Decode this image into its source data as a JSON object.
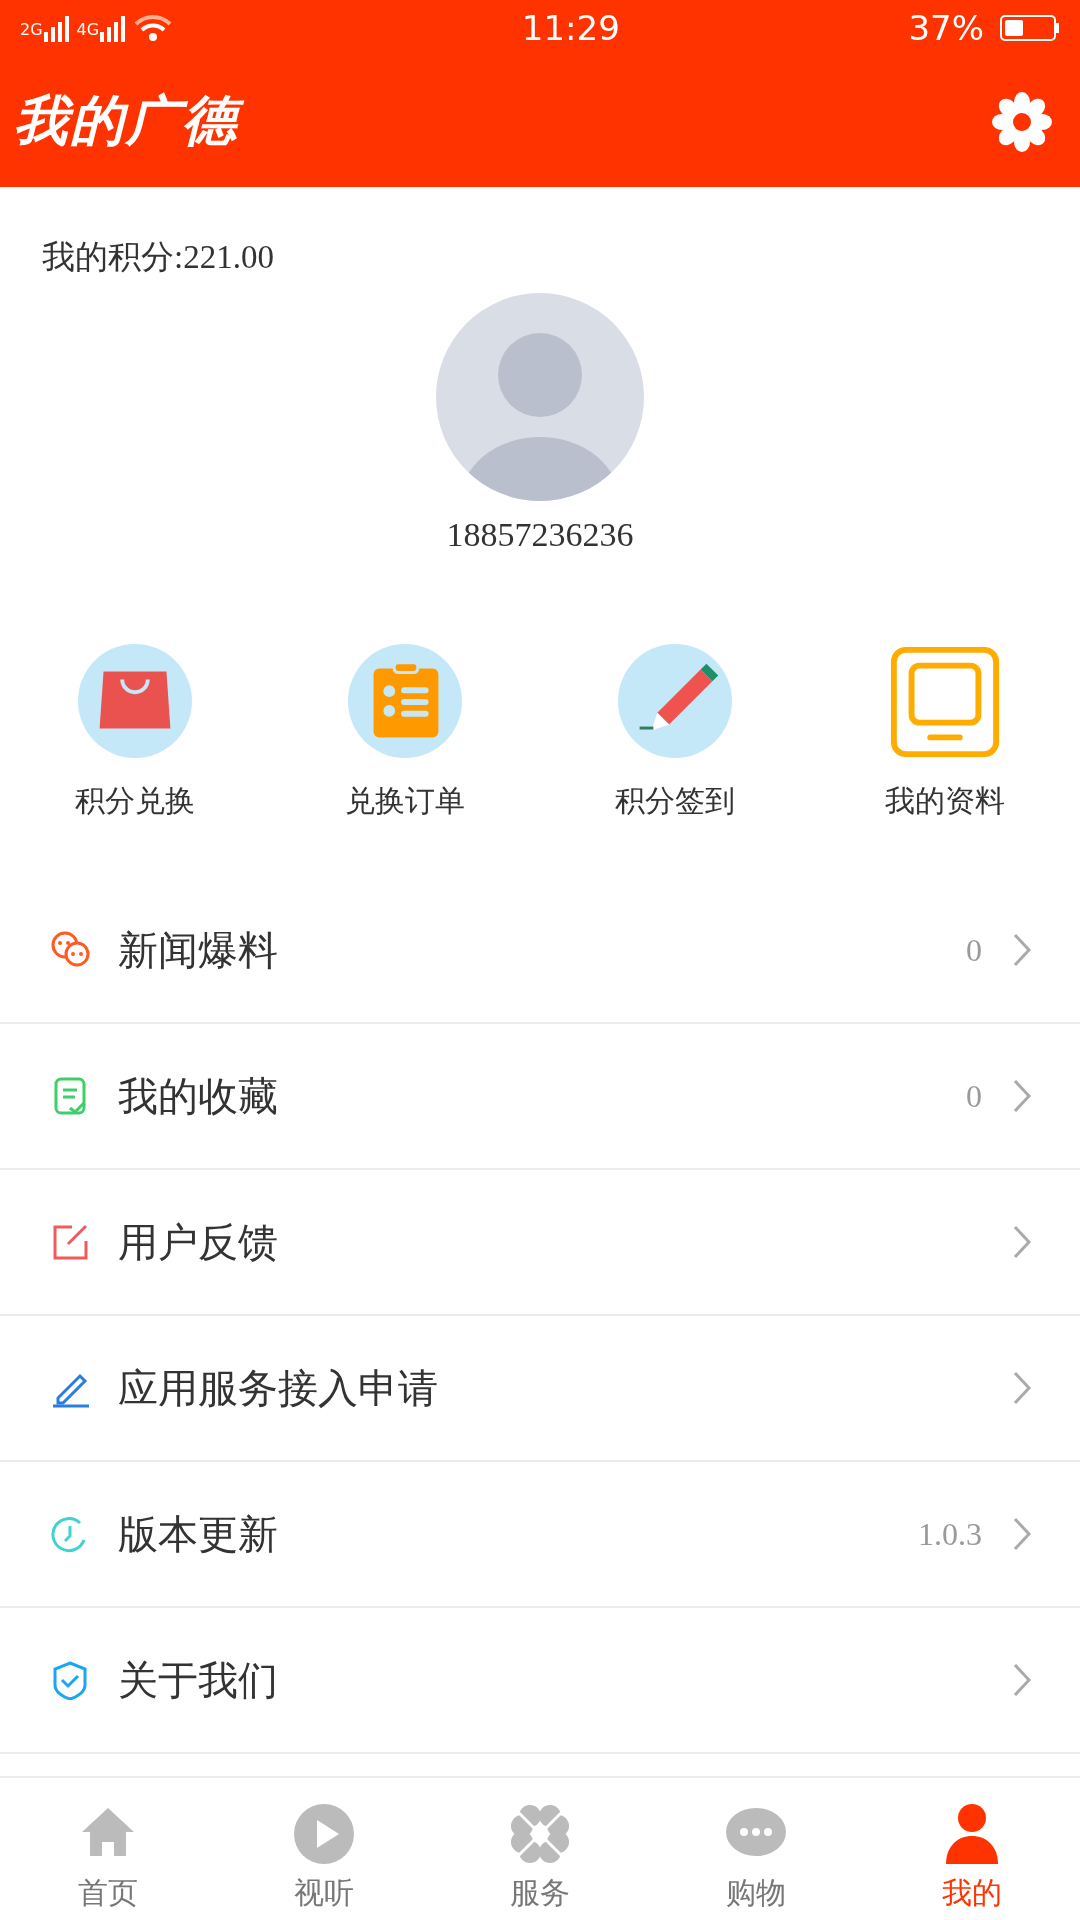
{
  "status_bar": {
    "network_1": "2G",
    "network_2": "4G",
    "time": "11:29",
    "battery": "37%"
  },
  "header": {
    "title": "我的广德"
  },
  "profile": {
    "points": "我的积分:221.00",
    "phone": "18857236236"
  },
  "shortcuts": [
    {
      "kind": "bag",
      "label": "积分兑换"
    },
    {
      "kind": "clipboard",
      "label": "兑换订单"
    },
    {
      "kind": "pencil",
      "label": "积分签到"
    },
    {
      "kind": "tablet",
      "label": "我的资料"
    }
  ],
  "menu": [
    {
      "kind": "chat",
      "label": "新闻爆料",
      "value": "0",
      "color": "#ff5a1f"
    },
    {
      "kind": "note",
      "label": "我的收藏",
      "value": "0",
      "color": "#3ecf6a"
    },
    {
      "kind": "edit",
      "label": "用户反馈",
      "color": "#f25b5b"
    },
    {
      "kind": "pen",
      "label": "应用服务接入申请",
      "color": "#2a7de1"
    },
    {
      "kind": "clock",
      "label": "版本更新",
      "value": "1.0.3",
      "color": "#3fd3cc"
    },
    {
      "kind": "shield",
      "label": "关于我们",
      "color": "#1aa6f5"
    }
  ],
  "tab_bar": [
    {
      "kind": "home",
      "label": "首页",
      "selected": false
    },
    {
      "kind": "play",
      "label": "视听",
      "selected": false
    },
    {
      "kind": "clover",
      "label": "服务",
      "selected": false
    },
    {
      "kind": "chat",
      "label": "购物",
      "selected": false
    },
    {
      "kind": "person",
      "label": "我的",
      "selected": true
    }
  ]
}
